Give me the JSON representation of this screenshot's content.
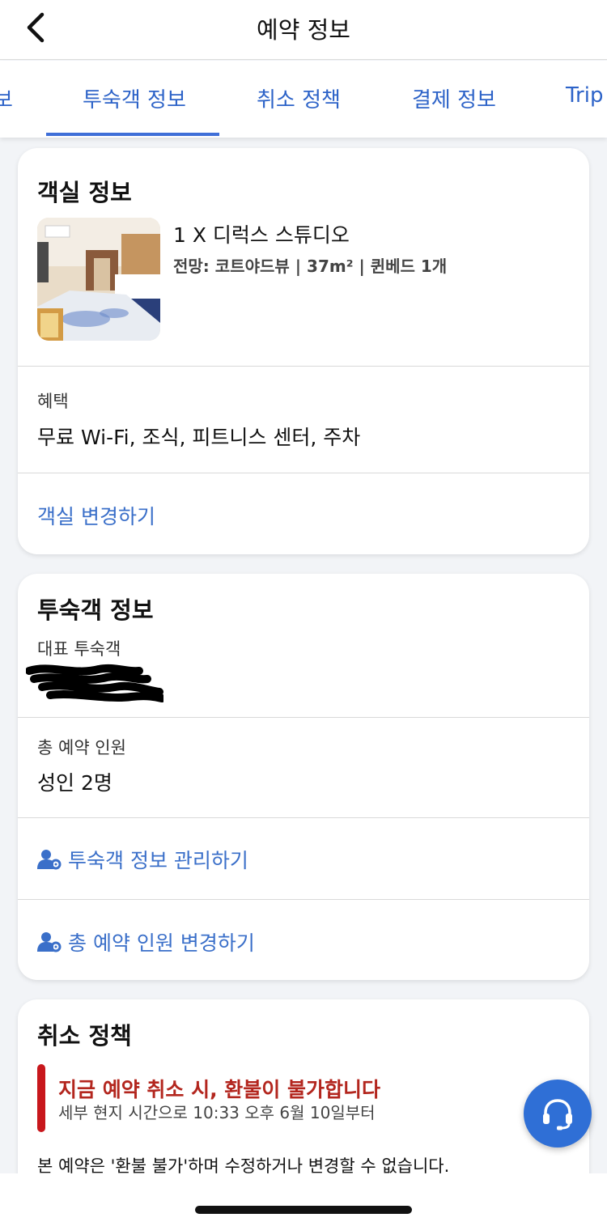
{
  "header": {
    "title": "예약 정보",
    "back_icon": "chevron-left-icon"
  },
  "tabs": [
    {
      "label": "보",
      "active": false
    },
    {
      "label": "투숙객 정보",
      "active": true
    },
    {
      "label": "취소 정책",
      "active": false
    },
    {
      "label": "결제 정보",
      "active": false
    },
    {
      "label": "Trip",
      "active": false
    }
  ],
  "room_card": {
    "title": "객실 정보",
    "room_name": "1 X 디럭스 스튜디오",
    "view_label": "전망:",
    "view_value": "코트야드뷰",
    "size": "37m²",
    "bed": "퀸베드 1개",
    "benefits_label": "혜택",
    "benefits_value": "무료 Wi-Fi, 조식, 피트니스 센터, 주차",
    "change_room_link": "객실 변경하기"
  },
  "guest_card": {
    "title": "투숙객 정보",
    "main_guest_label": "대표 투숙객",
    "total_guests_label": "총 예약 인원",
    "total_guests_value": "성인 2명",
    "manage_guest_link": "투숙객 정보 관리하기",
    "change_guests_link": "총 예약 인원 변경하기"
  },
  "cancel_card": {
    "title": "취소 정책",
    "warning_title": "지금 예약 취소 시, 환불이 불가합니다",
    "warning_sub": "세부 현지 시간으로 10:33 오후 6월 10일부터",
    "policy_text": "본 예약은 '환불 불가'하며 수정하거나 변경할 수 없습니다."
  },
  "colors": {
    "accent": "#2f6fd6",
    "link": "#3a6fc9",
    "warning": "#b3261e"
  },
  "support_icon": "headset-icon"
}
